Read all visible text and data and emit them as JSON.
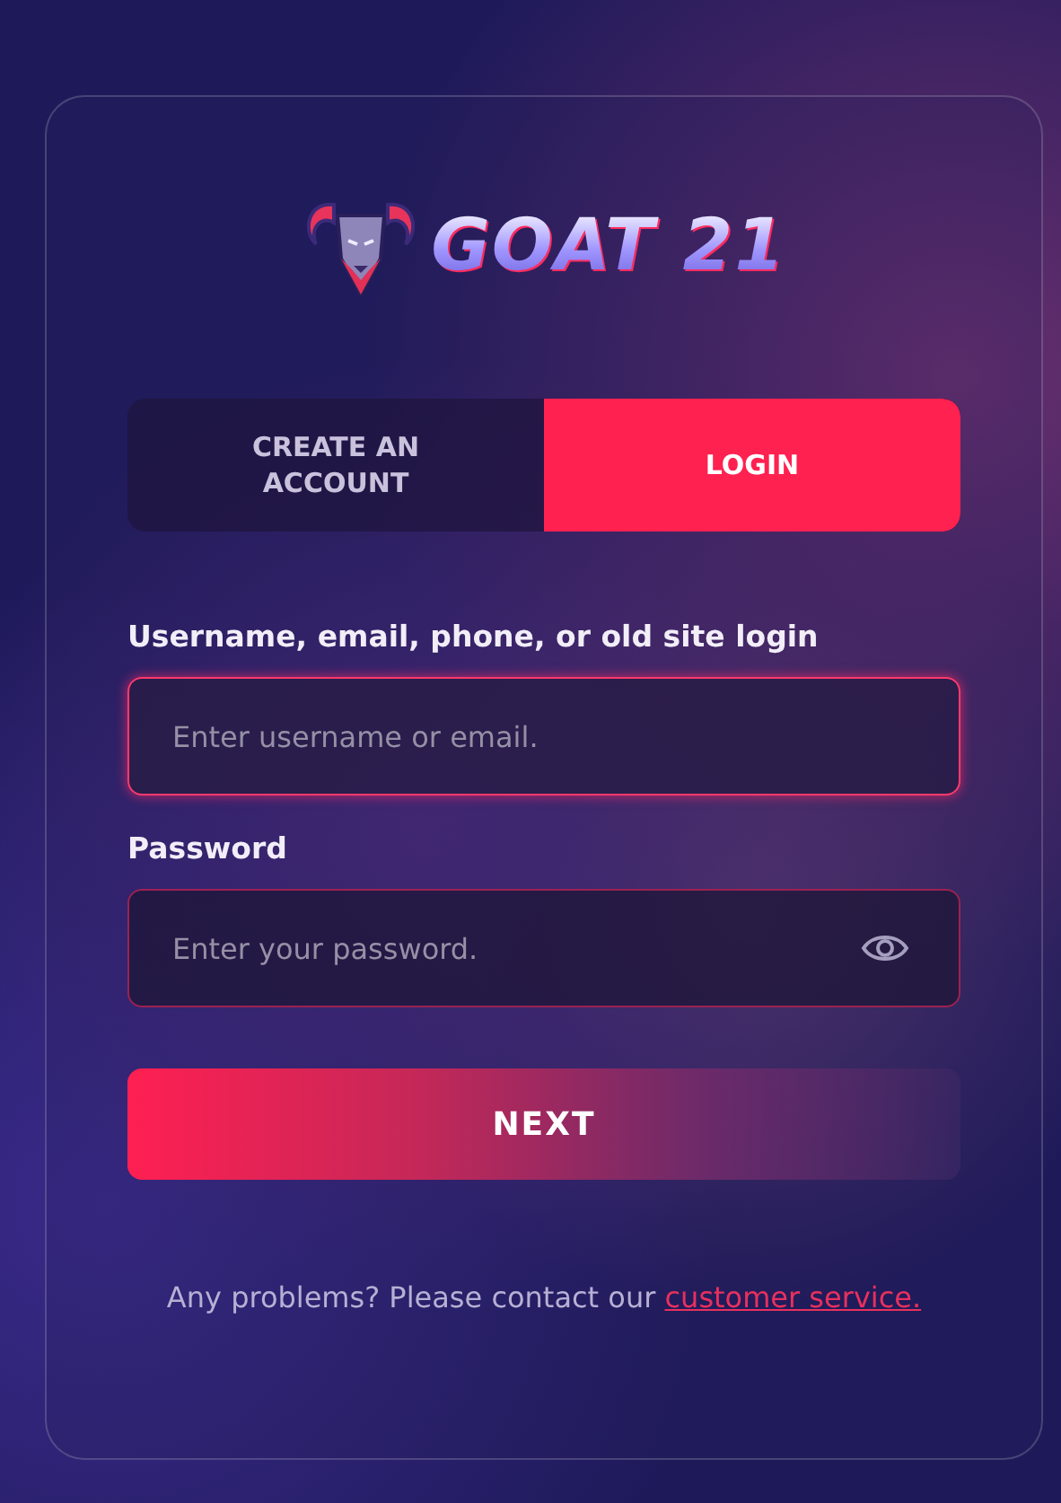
{
  "logo": {
    "text": "GOAT 21"
  },
  "tabs": [
    {
      "label": "CREATE AN ACCOUNT",
      "selected": false
    },
    {
      "label": "LOGIN",
      "selected": true
    }
  ],
  "fields": [
    {
      "label": "Username, email, phone, or old site login",
      "placeholder": "Enter username or email.",
      "focused": true,
      "kind": "text"
    },
    {
      "label": "Password",
      "placeholder": "Enter your password.",
      "focused": false,
      "kind": "password"
    }
  ],
  "submit": "NEXT",
  "help": {
    "text": "Any problems? Please contact our",
    "link": "customer service."
  }
}
